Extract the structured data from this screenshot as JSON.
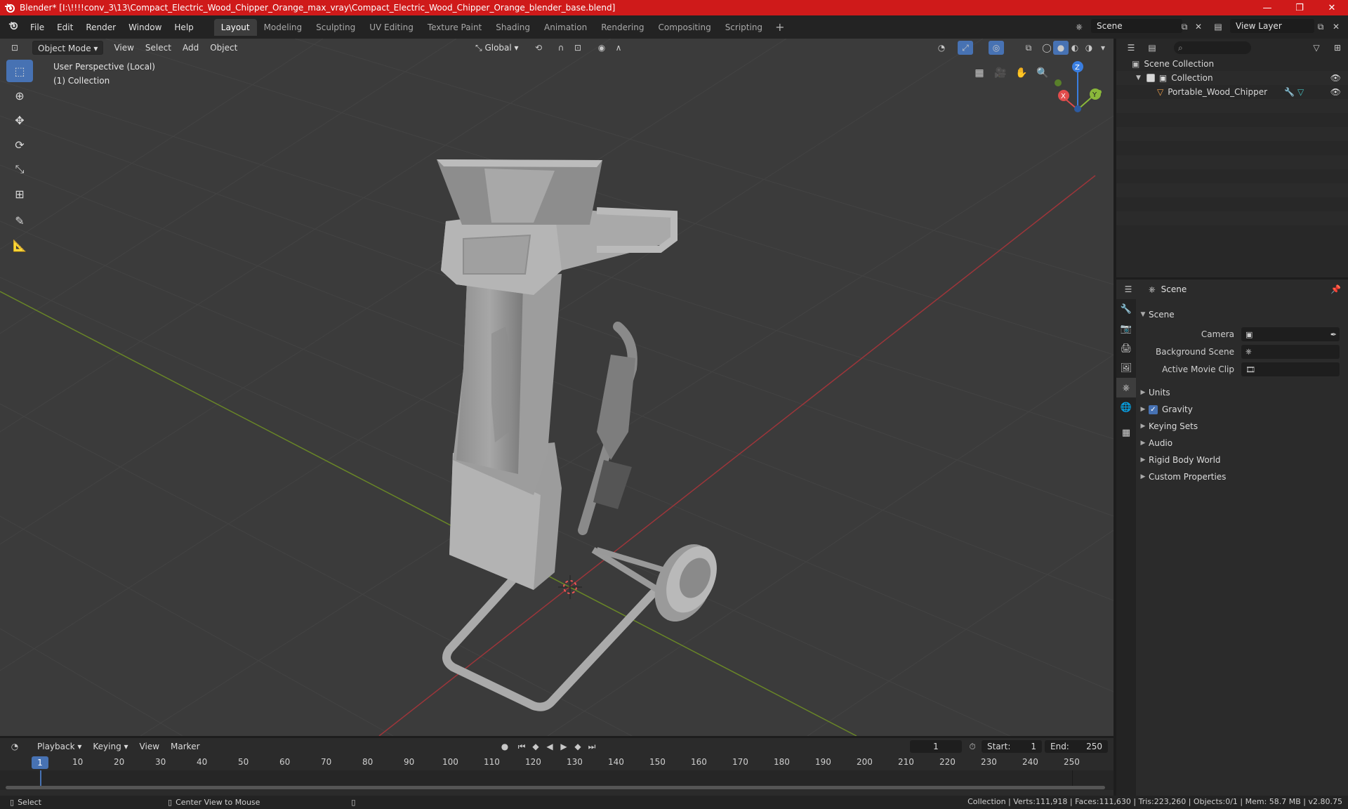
{
  "window": {
    "title": "Blender* [I:\\!!!!conv_3\\13\\Compact_Electric_Wood_Chipper_Orange_max_vray\\Compact_Electric_Wood_Chipper_Orange_blender_base.blend]",
    "minimize": "—",
    "maximize": "❐",
    "close": "✕"
  },
  "menu": {
    "items": [
      "File",
      "Edit",
      "Render",
      "Window",
      "Help"
    ],
    "workspaces": [
      "Layout",
      "Modeling",
      "Sculpting",
      "UV Editing",
      "Texture Paint",
      "Shading",
      "Animation",
      "Rendering",
      "Compositing",
      "Scripting"
    ],
    "active_workspace": "Layout",
    "add_workspace": "+",
    "scene": "Scene",
    "view_layer": "View Layer"
  },
  "viewport": {
    "mode": "Object Mode",
    "menus": [
      "View",
      "Select",
      "Add",
      "Object"
    ],
    "transform_orientation": "Global",
    "info_line1": "User Perspective (Local)",
    "info_line2": "(1) Collection",
    "gizmo": {
      "x": "X",
      "y": "Y",
      "z": "Z"
    }
  },
  "outliner": {
    "root": "Scene Collection",
    "collection": "Collection",
    "object": "Portable_Wood_Chipper"
  },
  "properties": {
    "context": "Scene",
    "section": "Scene",
    "camera_label": "Camera",
    "background_scene_label": "Background Scene",
    "active_movie_clip_label": "Active Movie Clip",
    "panels": [
      "Units",
      "Gravity",
      "Keying Sets",
      "Audio",
      "Rigid Body World",
      "Custom Properties"
    ],
    "gravity_enabled": true
  },
  "timeline": {
    "menus": [
      "Playback",
      "Keying",
      "View",
      "Marker"
    ],
    "current_frame": "1",
    "start_label": "Start:",
    "start": "1",
    "end_label": "End:",
    "end": "250",
    "ticks": [
      "1",
      "10",
      "20",
      "30",
      "40",
      "50",
      "60",
      "70",
      "80",
      "90",
      "100",
      "110",
      "120",
      "130",
      "140",
      "150",
      "160",
      "170",
      "180",
      "190",
      "200",
      "210",
      "220",
      "230",
      "240",
      "250"
    ]
  },
  "status": {
    "select": "Select",
    "center_view": "Center View to Mouse",
    "stats": "Collection | Verts:111,918 | Faces:111,630 | Tris:223,260 | Objects:0/1 | Mem: 58.7 MB | v2.80.75"
  },
  "colors": {
    "title_bar": "#cf1a1a",
    "active_blue": "#4772b3",
    "axis_x": "#e24c4c",
    "axis_y": "#8ab83a",
    "axis_z": "#3a7ee0"
  }
}
